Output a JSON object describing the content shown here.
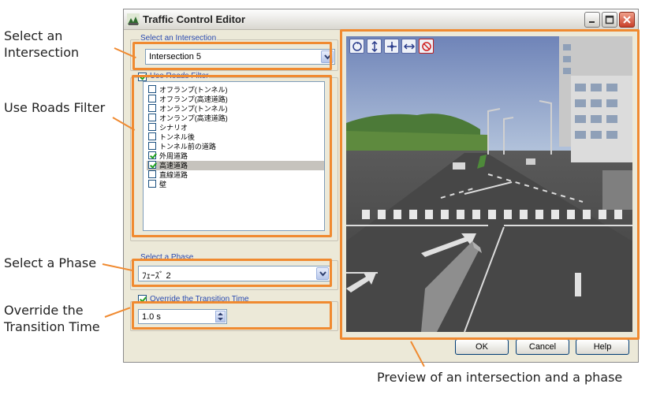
{
  "window": {
    "title": "Traffic Control Editor"
  },
  "intersection_group": {
    "label": "Select an Intersection",
    "selected": "Intersection 5"
  },
  "roads_filter": {
    "label": "Use Roads Filter",
    "checked": true,
    "items": [
      {
        "label": "オフランプ(トンネル)",
        "checked": false,
        "selected": false
      },
      {
        "label": "オフランプ(高速道路)",
        "checked": false,
        "selected": false
      },
      {
        "label": "オンランプ(トンネル)",
        "checked": false,
        "selected": false
      },
      {
        "label": "オンランプ(高速道路)",
        "checked": false,
        "selected": false
      },
      {
        "label": "シナリオ",
        "checked": false,
        "selected": false
      },
      {
        "label": "トンネル後",
        "checked": false,
        "selected": false
      },
      {
        "label": "トンネル前の道路",
        "checked": false,
        "selected": false
      },
      {
        "label": "外周道路",
        "checked": true,
        "selected": false
      },
      {
        "label": "高速道路",
        "checked": true,
        "selected": true
      },
      {
        "label": "直線道路",
        "checked": false,
        "selected": false
      },
      {
        "label": "壁",
        "checked": false,
        "selected": false
      }
    ]
  },
  "phase_group": {
    "label": "Select a Phase",
    "selected": "ﾌｪｰｽﾞ 2"
  },
  "transition": {
    "label": "Override the Transition Time",
    "checked": true,
    "value": "1.0 s"
  },
  "buttons": {
    "ok": "OK",
    "cancel": "Cancel",
    "help": "Help"
  },
  "preview_tools": [
    "rotate-icon",
    "move-vertical-icon",
    "move-all-icon",
    "pan-horizontal-icon",
    "reset-view-icon"
  ],
  "callouts": {
    "intersection": "Select an\nIntersection",
    "roads_filter": "Use Roads Filter",
    "phase": "Select a Phase",
    "transition": "Override the\nTransition Time",
    "preview": "Preview of an intersection and a phase"
  },
  "colors": {
    "highlight": "#f08a30",
    "group_label": "#2a4ab0",
    "window_face": "#ece9d8"
  }
}
